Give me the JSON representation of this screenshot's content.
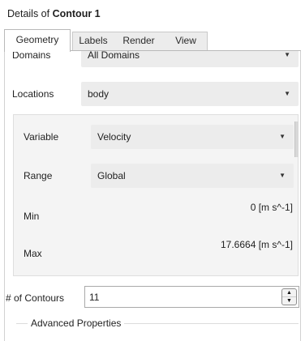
{
  "panel": {
    "title_prefix": "Details of",
    "title_object": "Contour 1"
  },
  "tabs": [
    {
      "label": "Geometry",
      "active": true
    },
    {
      "label": "Labels",
      "active": false
    },
    {
      "label": "Render",
      "active": false
    },
    {
      "label": "View",
      "active": false
    }
  ],
  "geometry": {
    "domains": {
      "label": "Domains",
      "value": "All Domains"
    },
    "locations": {
      "label": "Locations",
      "value": "body"
    },
    "variable": {
      "label": "Variable",
      "value": "Velocity"
    },
    "range": {
      "label": "Range",
      "value": "Global"
    },
    "min": {
      "label": "Min",
      "value": "0 [m s^-1]"
    },
    "max": {
      "label": "Max",
      "value": "17.6664 [m s^-1]"
    },
    "num_contours": {
      "label": "# of Contours",
      "value": "11"
    },
    "advanced": {
      "label": "Advanced Properties"
    }
  },
  "icons": {
    "dropdown_arrow": "dropdown-arrow-icon",
    "spin_up": "spin-up-icon",
    "spin_down": "spin-down-icon"
  },
  "colors": {
    "combo_background": "#ececec",
    "group_background": "#f4f4f4"
  }
}
